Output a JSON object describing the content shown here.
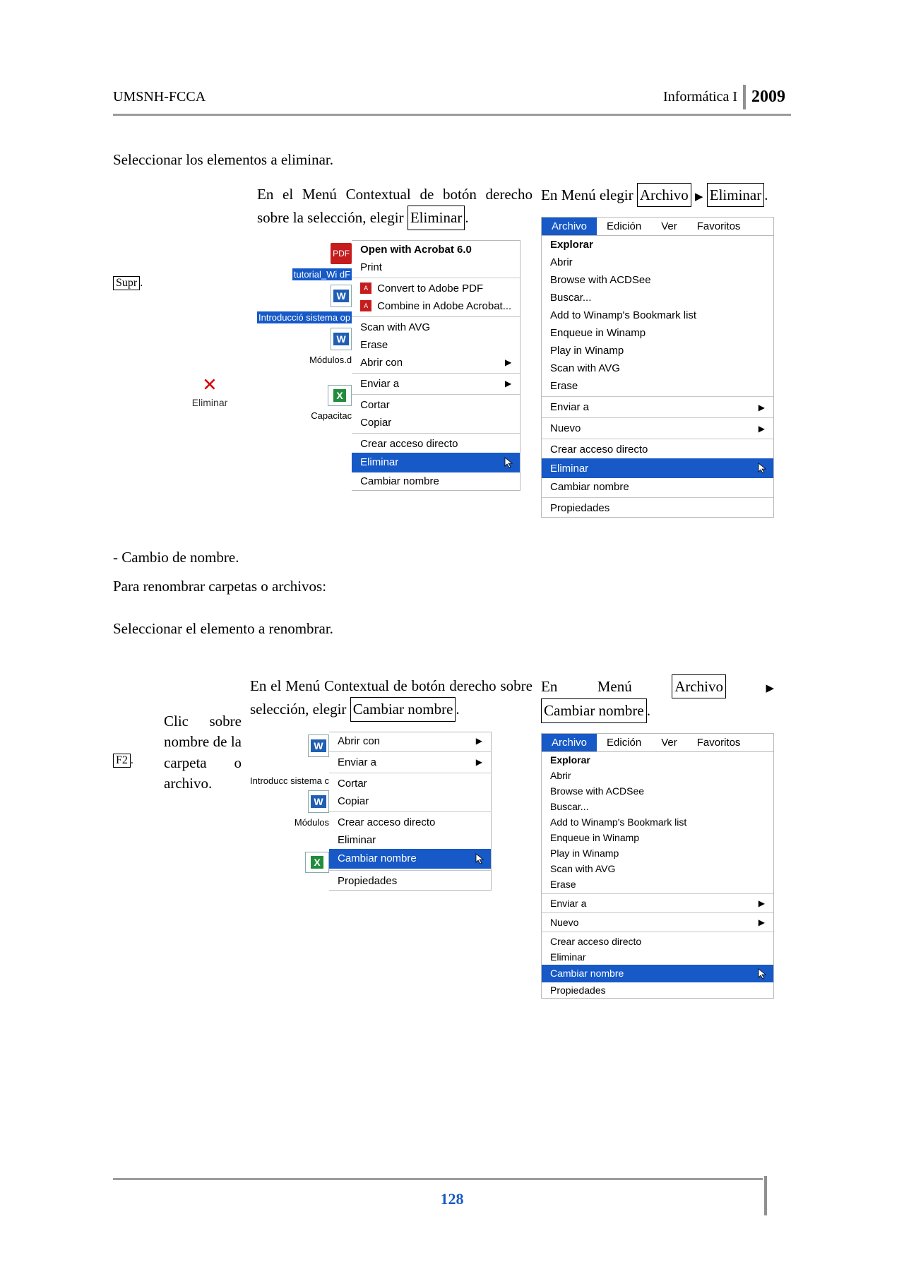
{
  "header": {
    "left": "UMSNH-FCCA",
    "right_label": "Informática I",
    "year": "2009"
  },
  "intro": {
    "line1": "Seleccionar los elementos a eliminar."
  },
  "sec1": {
    "supr_key": "Supr",
    "delete_icon_label": "Eliminar",
    "col_c_intro_pre": "En el Menú Contextual de botón derecho sobre la selección, elegir ",
    "col_c_intro_box": "Eliminar",
    "col_c_intro_post": ".",
    "col_d_intro_pre": "En Menú elegir ",
    "col_d_intro_box1": "Archivo",
    "col_d_intro_arrow": "▶",
    "col_d_intro_box2": "Eliminar",
    "col_d_intro_post": "."
  },
  "files": {
    "f1": "tutorial_Wi\ndF",
    "f2": "Introducció\nsistema op",
    "f3": "Módulos.d",
    "f4": "Capacitac"
  },
  "ctx1": {
    "bold1": "Open with Acrobat 6.0",
    "print": "Print",
    "convert": "Convert to Adobe PDF",
    "combine": "Combine in Adobe Acrobat...",
    "scan": "Scan with AVG",
    "erase": "Erase",
    "abrir_con": "Abrir con",
    "enviar": "Enviar a",
    "cortar": "Cortar",
    "copiar": "Copiar",
    "acceso": "Crear acceso directo",
    "eliminar": "Eliminar",
    "cambiar": "Cambiar nombre"
  },
  "menubar": {
    "t1": "Archivo",
    "t2": "Edición",
    "t3": "Ver",
    "t4": "Favoritos"
  },
  "arch1": {
    "explorar": "Explorar",
    "abrir": "Abrir",
    "browse": "Browse with ACDSee",
    "buscar": "Buscar...",
    "winamp_bm": "Add to Winamp's Bookmark list",
    "winamp_enq": "Enqueue in Winamp",
    "winamp_play": "Play in Winamp",
    "scan": "Scan with AVG",
    "erase": "Erase",
    "enviar": "Enviar a",
    "nuevo": "Nuevo",
    "acceso": "Crear acceso directo",
    "eliminar": "Eliminar",
    "cambiar": "Cambiar nombre",
    "prop": "Propiedades"
  },
  "mid": {
    "line1": "- Cambio de nombre.",
    "line2": "Para renombrar carpetas o archivos:",
    "line3": "Seleccionar el elemento  a renombrar."
  },
  "sec2": {
    "f2_key": "F2",
    "f2_post": ".",
    "clic_text": "Clic sobre nombre de la carpeta o archivo.",
    "col_c_intro_pre": "En el Menú Contextual de botón derecho sobre selección, elegir ",
    "col_c_intro_box": "Cambiar nombre",
    "col_c_intro_post": ".",
    "col_d_intro_pre": "En Menú ",
    "col_d_intro_box1": "Archivo",
    "col_d_intro_arrow": "▶",
    "col_d_intro_box2": "Cambiar nombre",
    "col_d_intro_post": "."
  },
  "files2": {
    "f1": "Introducc\nsistema c",
    "f2": "Módulos"
  },
  "ctx2": {
    "abrir_con": "Abrir con",
    "enviar": "Enviar a",
    "cortar": "Cortar",
    "copiar": "Copiar",
    "acceso": "Crear acceso directo",
    "eliminar": "Eliminar",
    "cambiar": "Cambiar nombre",
    "prop": "Propiedades"
  },
  "page_number": "128"
}
